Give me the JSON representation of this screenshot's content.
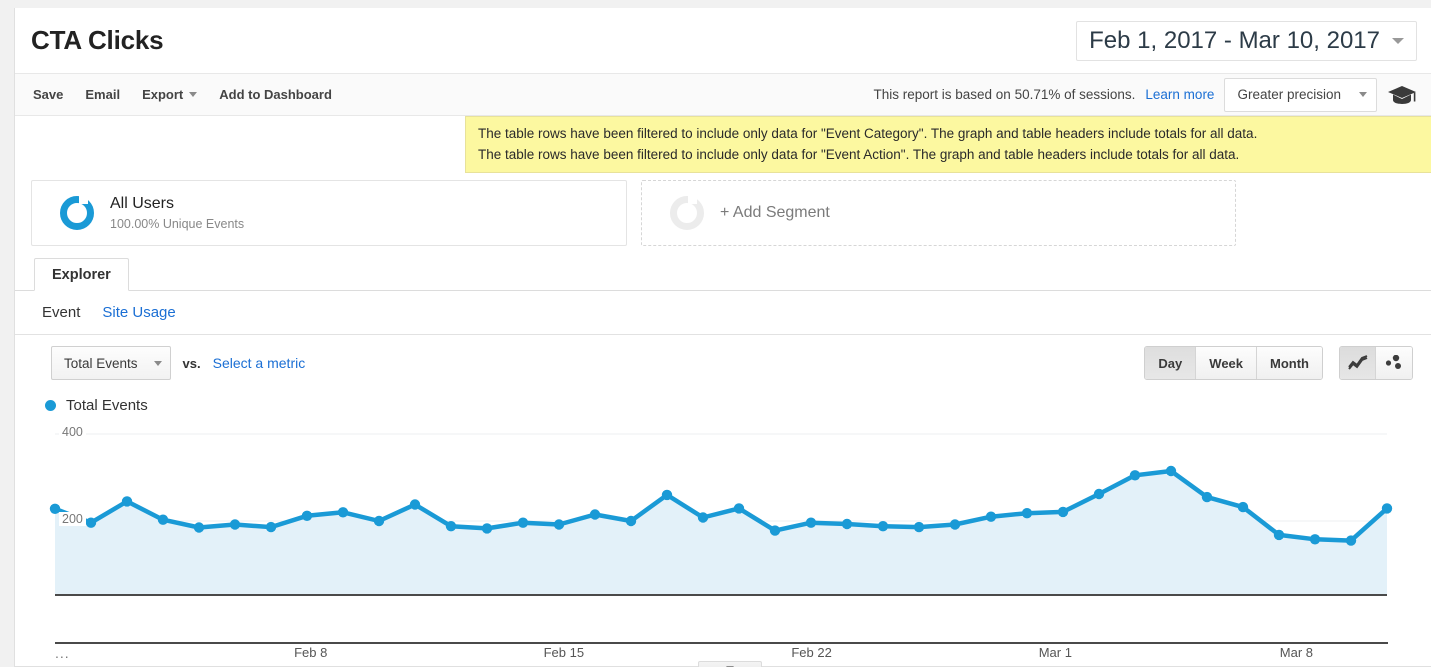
{
  "header": {
    "title": "CTA Clicks",
    "date_range": "Feb 1, 2017 - Mar 10, 2017",
    "date_range_caret_icon": "chevron-down-icon"
  },
  "toolbar": {
    "save_label": "Save",
    "email_label": "Email",
    "export_label": "Export",
    "add_to_dashboard_label": "Add to Dashboard",
    "sampling_text": "This report is based on 50.71% of sessions.",
    "sampling_link_label": "Learn more",
    "precision_label": "Greater precision",
    "sampling_icon": "graduation-cap-icon"
  },
  "notice": {
    "line1": "The table rows have been filtered to include only data for \"Event Category\". The graph and table headers include totals for all data.",
    "line2": "The table rows have been filtered to include only data for \"Event Action\". The graph and table headers include totals for all data.",
    "background_color": "#fcf8a0"
  },
  "segments": {
    "applied": {
      "name": "All Users",
      "subtitle": "100.00% Unique Events",
      "icon": "donut-icon",
      "color": "#1a9ad6"
    },
    "add": {
      "label": "+ Add Segment",
      "icon": "donut-icon"
    }
  },
  "tabs": {
    "explorer_label": "Explorer"
  },
  "subtabs": [
    {
      "label": "Event",
      "active": true
    },
    {
      "label": "Site Usage",
      "active": false
    }
  ],
  "metric_row": {
    "metric_label": "Total Events",
    "metric_caret_icon": "chevron-down-icon",
    "vs_label": "vs.",
    "select_metric_label": "Select a metric",
    "granularity": [
      {
        "label": "Day",
        "active": true
      },
      {
        "label": "Week",
        "active": false
      },
      {
        "label": "Month",
        "active": false
      }
    ],
    "chart_types": [
      {
        "name": "line-chart-icon",
        "active": true
      },
      {
        "name": "scatter-chart-icon",
        "active": false
      }
    ]
  },
  "legend": {
    "series_label": "Total Events",
    "color": "#1a9ad6"
  },
  "chart_data": {
    "type": "area",
    "title": "Total Events",
    "xlabel": "",
    "ylabel": "",
    "ylim": [
      0,
      400
    ],
    "yticks": [
      200,
      400
    ],
    "ytick_labels": [
      "200",
      "400"
    ],
    "grid": true,
    "legend_position": "top-left",
    "line_color": "#1a9ad6",
    "fill_color": "#e3f1f9",
    "x": [
      "Feb 1",
      "Feb 2",
      "Feb 3",
      "Feb 4",
      "Feb 5",
      "Feb 6",
      "Feb 7",
      "Feb 8",
      "Feb 9",
      "Feb 10",
      "Feb 11",
      "Feb 12",
      "Feb 13",
      "Feb 14",
      "Feb 15",
      "Feb 16",
      "Feb 17",
      "Feb 18",
      "Feb 19",
      "Feb 20",
      "Feb 21",
      "Feb 22",
      "Feb 23",
      "Feb 24",
      "Feb 25",
      "Feb 26",
      "Feb 27",
      "Feb 28",
      "Mar 1",
      "Mar 2",
      "Mar 3",
      "Mar 4",
      "Mar 5",
      "Mar 6",
      "Mar 7",
      "Mar 8",
      "Mar 9",
      "Mar 10"
    ],
    "axis_tick_labels": [
      "Feb 8",
      "Feb 15",
      "Feb 22",
      "Mar 1",
      "Mar 8"
    ],
    "ellipsis_label": "...",
    "series": [
      {
        "name": "Total Events",
        "values": [
          228,
          196,
          245,
          203,
          185,
          192,
          186,
          212,
          220,
          200,
          238,
          188,
          183,
          196,
          192,
          215,
          200,
          260,
          208,
          229,
          178,
          196,
          193,
          188,
          186,
          192,
          210,
          218,
          221,
          262,
          305,
          315,
          255,
          232,
          168,
          158,
          155,
          229
        ]
      }
    ]
  },
  "xaxis_ticks": [
    {
      "label": "Feb 8",
      "x_pct": 19.2
    },
    {
      "label": "Feb 15",
      "x_pct": 38.2
    },
    {
      "label": "Feb 22",
      "x_pct": 56.8
    },
    {
      "label": "Mar 1",
      "x_pct": 75.1
    },
    {
      "label": "Mar 8",
      "x_pct": 93.2
    }
  ],
  "expander": {
    "icon": "chevron-down-icon"
  }
}
